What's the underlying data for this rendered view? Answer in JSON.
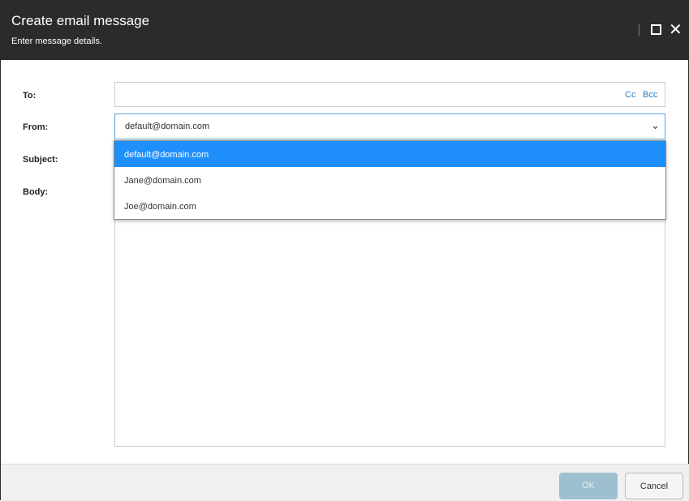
{
  "dialog": {
    "title": "Create email message",
    "subtitle": "Enter message details."
  },
  "labels": {
    "to": "To:",
    "from": "From:",
    "subject": "Subject:",
    "body": "Body:"
  },
  "to": {
    "cc": "Cc",
    "bcc": "Bcc",
    "value": ""
  },
  "from": {
    "value": "default@domain.com",
    "options": [
      "default@domain.com",
      "Jane@domain.com",
      "Joe@domain.com"
    ]
  },
  "footer": {
    "ok": "OK",
    "cancel": "Cancel"
  }
}
